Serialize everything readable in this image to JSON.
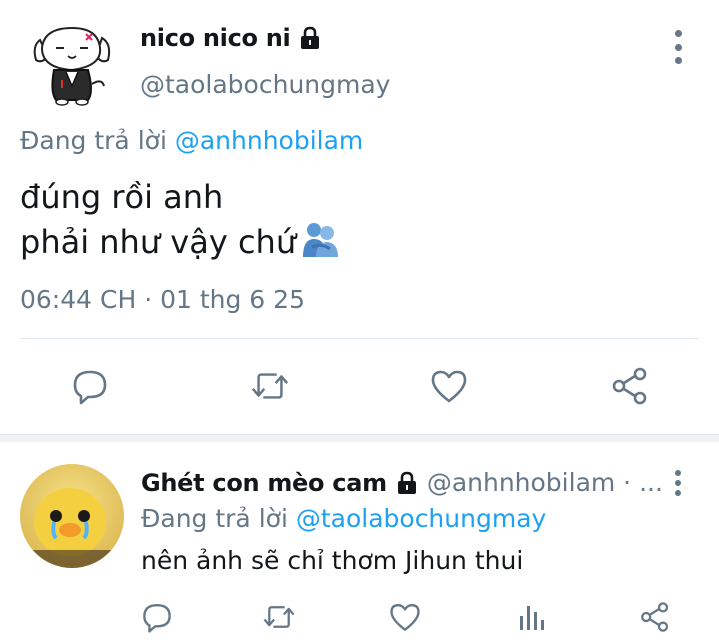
{
  "main_tweet": {
    "display_name": "nico nico ni",
    "handle": "@taolabochungmay",
    "reply_prefix": "Đang trả lời",
    "reply_to": "@anhnhobilam",
    "text_line1": "đúng rồi anh",
    "text_line2": "phải như vậy chứ",
    "emoji": "people-hugging",
    "timestamp": "06:44 CH · 01 thg 6 25",
    "actions": [
      "reply",
      "retweet",
      "like",
      "share"
    ]
  },
  "reply_tweet": {
    "display_name": "Ghét con mèo cam",
    "handle": "@anhnhobilam · ...",
    "reply_prefix": "Đang trả lời",
    "reply_to": "@taolabochungmay",
    "text": "nên ảnh sẽ chỉ thơm Jihun thui",
    "actions": [
      "reply",
      "retweet",
      "like",
      "analytics",
      "share"
    ]
  },
  "colors": {
    "text_primary": "#14171a",
    "text_secondary": "#657786",
    "link": "#1da1f2",
    "icon": "#657786",
    "divider": "#e1e8ed"
  }
}
